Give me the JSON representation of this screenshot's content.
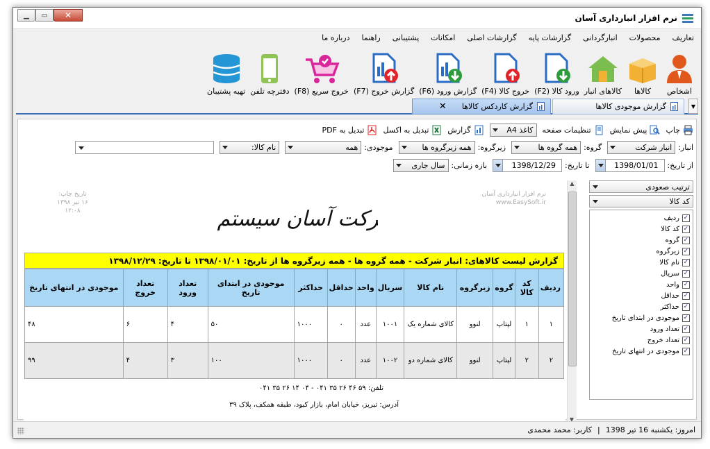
{
  "window": {
    "title": "نرم افزار انبارداری آسان"
  },
  "menu": [
    "تعاریف",
    "محصولات",
    "انبارگردانی",
    "گزارشات پایه",
    "گزارشات اصلی",
    "امکانات",
    "پشتیبانی",
    "راهنما",
    "درباره ما"
  ],
  "toolbar": [
    {
      "label": "اشخاص",
      "icon": "person-icon"
    },
    {
      "label": "کالاها",
      "icon": "box-icon"
    },
    {
      "label": "کالاهای انبار",
      "icon": "warehouse-icon"
    },
    {
      "label": "ورود کالا (F2)",
      "icon": "doc-in-icon"
    },
    {
      "label": "خروج کالا (F4)",
      "icon": "doc-out-icon"
    },
    {
      "label": "گزارش ورود (F6)",
      "icon": "report-in-icon"
    },
    {
      "label": "گزارش خروج (F7)",
      "icon": "report-out-icon"
    },
    {
      "label": "خروج سریع (F8)",
      "icon": "cart-icon"
    },
    {
      "label": "دفترچه تلفن",
      "icon": "phone-icon"
    },
    {
      "label": "تهیه پشتیبان",
      "icon": "database-icon"
    }
  ],
  "tabs": {
    "inactive": "گزارش موجودی کالاها",
    "active": "گزارش کاردکس کالاها",
    "close": "✕"
  },
  "report_toolbar": {
    "print": "چاپ",
    "preview": "پیش نمایش",
    "page_setup": "تنظیمات صفحه",
    "paper_value": "کاغذ A4",
    "report": "گزارش",
    "excel": "تبدیل به اکسل",
    "pdf": "تبدیل به PDF"
  },
  "filters": {
    "warehouse_label": "انبار:",
    "warehouse_value": "انبار شرکت",
    "group_label": "گروه:",
    "group_value": "همه گروه ها",
    "subgroup_label": "زیرگروه:",
    "subgroup_value": "همه زیرگروه ها",
    "stock_label": "موجودی:",
    "stock_value": "همه",
    "item_name_value": "نام کالا:",
    "search_value": "",
    "from_label": "از تاریخ:",
    "from_value": "1398/01/01",
    "to_label": "تا تاریخ:",
    "to_value": "1398/12/29",
    "period_label": "بازه زمانی:",
    "period_value": "سال جاری"
  },
  "side_panel": {
    "sort_value": "ترتیب صعودی",
    "sort_by_value": "کد کالا",
    "columns": [
      "ردیف",
      "کد کالا",
      "گروه",
      "زیرگروه",
      "نام کالا",
      "سریال",
      "واحد",
      "حداقل",
      "حداکثر",
      "موجودی در ابتدای تاریخ",
      "تعداد ورود",
      "تعداد خروج",
      "موجودی در انتهای تاریخ"
    ],
    "check": "✓"
  },
  "preview": {
    "software_line1": "نرم افزار انبارداری آسان",
    "software_line2": "www.EasySoft.ir",
    "print_date_label": "تاریخ چاپ:",
    "print_date": "۱۶ تیر ۱۳۹۸",
    "print_time": "۱۲:۰۸",
    "company_name": "شرکت آسان سیستم بنا",
    "report_title": "گزارش لیست کالاهای: انبار شرکت - همه گروه ها - همه زیرگروه ها از تاریخ: ۱۳۹۸/۰۱/۰۱ تا تاریخ: ۱۳۹۸/۱۲/۲۹",
    "headers": [
      "ردیف",
      "کد کالا",
      "گروه",
      "زیرگروه",
      "نام کالا",
      "سریال",
      "واحد",
      "حداقل",
      "حداکثر",
      "موجودی در ابتدای تاریخ",
      "تعداد ورود",
      "تعداد خروج",
      "موجودی در انتهای تاریخ"
    ],
    "rows": [
      [
        "۱",
        "۱",
        "لپتاپ",
        "لنوو",
        "کالای شماره یک",
        "۱۰۰۱",
        "عدد",
        "۰",
        "۱۰۰۰",
        "۵۰",
        "۴",
        "۶",
        "۴۸"
      ],
      [
        "۲",
        "۲",
        "لپتاپ",
        "لنوو",
        "کالای شماره دو",
        "۱۰۰۲",
        "عدد",
        "۰",
        "۱۰۰۰",
        "۱۰۰",
        "۳",
        "۴",
        "۹۹"
      ]
    ],
    "phone": "تلفن: ۵۹ ۴۶ ۲۶ ۳۵ ۰۴۱ - ۰۴ ۱۴ ۲۶ ۳۵ ۰۴۱",
    "address": "آدرس: تبریز، خیابان امام، بازار کبود، طبقه همکف، پلاک ۳۹"
  },
  "statusbar": {
    "today": "امروز: یکشنبه 16 تیر 1398",
    "divider": "|",
    "user": "کاربر: محمد محمدی"
  }
}
